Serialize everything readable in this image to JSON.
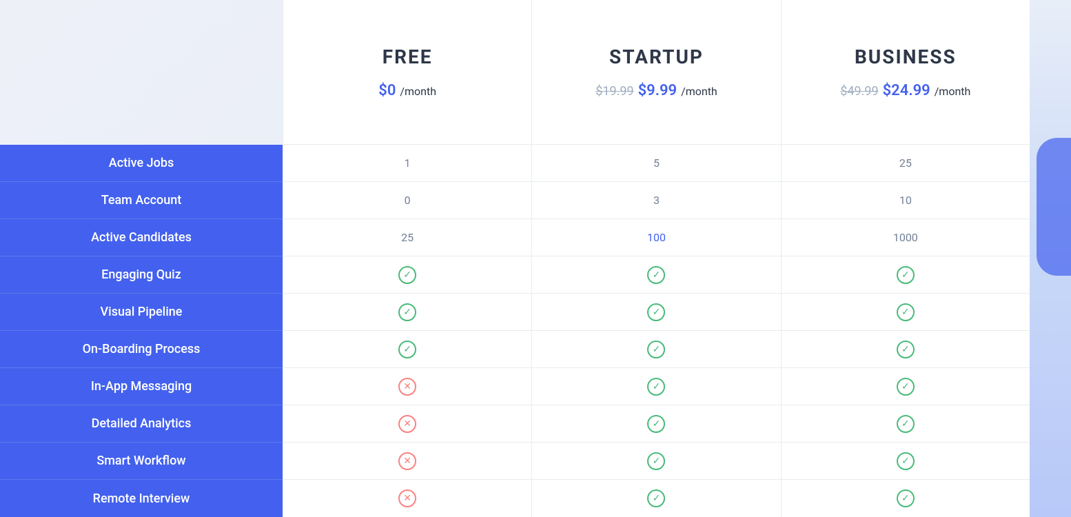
{
  "plans": [
    {
      "id": "free",
      "name": "FREE",
      "price_main": "$0",
      "price_period": "/month",
      "price_original": null,
      "price_discounted": null
    },
    {
      "id": "startup",
      "name": "STARTUP",
      "price_main": null,
      "price_period": "/month",
      "price_original": "$19.99",
      "price_discounted": "$9.99"
    },
    {
      "id": "business",
      "name": "BUSINESS",
      "price_main": null,
      "price_period": "/month",
      "price_original": "$49.99",
      "price_discounted": "$24.99"
    }
  ],
  "features": [
    {
      "label": "Active Jobs",
      "values": [
        "1",
        "5",
        "25"
      ],
      "types": [
        "text",
        "text",
        "text"
      ]
    },
    {
      "label": "Team Account",
      "values": [
        "0",
        "3",
        "10"
      ],
      "types": [
        "text",
        "text",
        "text"
      ]
    },
    {
      "label": "Active Candidates",
      "values": [
        "25",
        "100",
        "1000"
      ],
      "types": [
        "text",
        "highlight",
        "text"
      ]
    },
    {
      "label": "Engaging Quiz",
      "values": [
        "check",
        "check",
        "check"
      ],
      "types": [
        "check",
        "check",
        "check"
      ]
    },
    {
      "label": "Visual Pipeline",
      "values": [
        "check",
        "check",
        "check"
      ],
      "types": [
        "check",
        "check",
        "check"
      ]
    },
    {
      "label": "On-Boarding Process",
      "values": [
        "check",
        "check",
        "check"
      ],
      "types": [
        "check",
        "check",
        "check"
      ]
    },
    {
      "label": "In-App Messaging",
      "values": [
        "cross",
        "check",
        "check"
      ],
      "types": [
        "cross",
        "check",
        "check"
      ]
    },
    {
      "label": "Detailed Analytics",
      "values": [
        "cross",
        "check",
        "check"
      ],
      "types": [
        "cross",
        "check",
        "check"
      ]
    },
    {
      "label": "Smart Workflow",
      "values": [
        "cross",
        "check",
        "check"
      ],
      "types": [
        "cross",
        "check",
        "check"
      ]
    },
    {
      "label": "Remote Interview",
      "values": [
        "cross",
        "check",
        "check"
      ],
      "types": [
        "cross",
        "check",
        "check"
      ]
    }
  ]
}
